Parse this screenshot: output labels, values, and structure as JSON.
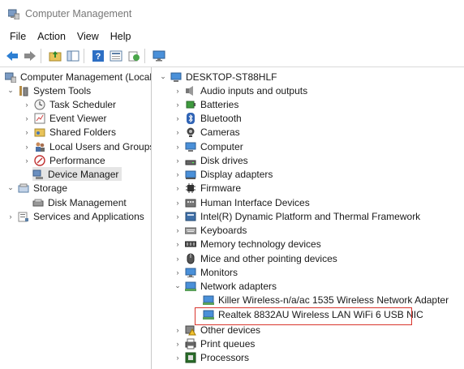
{
  "window": {
    "title": "Computer Management"
  },
  "menu": [
    "File",
    "Action",
    "View",
    "Help"
  ],
  "toolbar": {
    "icons": [
      "back-arrow-icon",
      "forward-arrow-icon",
      "up-folder-icon",
      "show-hide-tree-icon",
      "help-icon",
      "properties-icon",
      "export-icon",
      "monitor-icon"
    ]
  },
  "left_tree": {
    "root": "Computer Management (Local",
    "system_tools": "System Tools",
    "task_scheduler": "Task Scheduler",
    "event_viewer": "Event Viewer",
    "shared_folders": "Shared Folders",
    "local_users": "Local Users and Groups",
    "performance": "Performance",
    "device_manager": "Device Manager",
    "storage": "Storage",
    "disk_management": "Disk Management",
    "services": "Services and Applications"
  },
  "device_tree": {
    "computer_name": "DESKTOP-ST88HLF",
    "categories": [
      "Audio inputs and outputs",
      "Batteries",
      "Bluetooth",
      "Cameras",
      "Computer",
      "Disk drives",
      "Display adapters",
      "Firmware",
      "Human Interface Devices",
      "Intel(R) Dynamic Platform and Thermal Framework",
      "Keyboards",
      "Memory technology devices",
      "Mice and other pointing devices",
      "Monitors",
      "Network adapters"
    ],
    "network_children": [
      "Killer Wireless-n/a/ac 1535 Wireless Network Adapter",
      "Realtek 8832AU Wireless LAN WiFi 6 USB NIC"
    ],
    "after": [
      "Other devices",
      "Print queues",
      "Processors"
    ]
  },
  "colors": {
    "highlight_box": "#d9352d",
    "selection": "#e5e5e5"
  }
}
